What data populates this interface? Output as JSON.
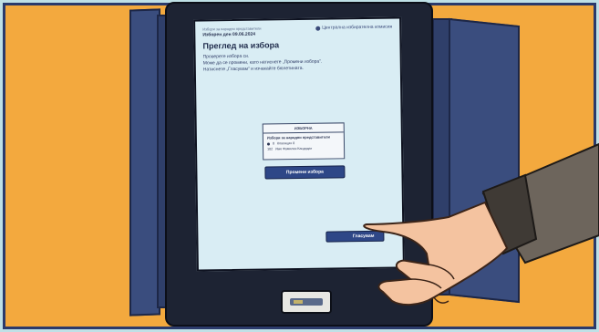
{
  "screen": {
    "brand": "Централна избирателна комисия",
    "meta_top": "Избори за народни представители",
    "meta_election": "Изборен ден 09.06.2024",
    "title": "Преглед на избора",
    "instruction_1": "Проверете избора си.",
    "instruction_2": "Може да се промени, като натиснете „Промени избора“.",
    "instruction_3": "Натиснете „Гласувам“ и изчакайте бюлетината.",
    "ballot": {
      "header": "ИЗБОРНА",
      "subtitle": "Избори за народни представители",
      "rows": [
        {
          "mark": "●",
          "num": "8",
          "label": "Коалиция 8"
        },
        {
          "mark": "",
          "num": "102",
          "label": "Име Фамилия Кандидат"
        }
      ]
    },
    "btn_change": "Промени избора",
    "btn_vote": "Гласувам"
  },
  "colors": {
    "background": "#bfe0e6",
    "accent_orange": "#f3a93e",
    "machine_body": "#1d2333",
    "screen_bg": "#d9edf4",
    "button_blue": "#2e4787"
  },
  "icons": [
    "brand-logo-icon",
    "card-slot-icon"
  ]
}
